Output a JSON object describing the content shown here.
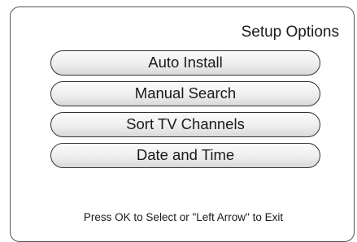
{
  "screen": {
    "title": "Setup Options",
    "menu": [
      {
        "label": "Auto Install"
      },
      {
        "label": "Manual Search"
      },
      {
        "label": "Sort TV Channels"
      },
      {
        "label": "Date and Time"
      }
    ],
    "hint": "Press OK to Select or \"Left Arrow\" to Exit"
  },
  "colors": {
    "background": "#ffffff",
    "border": "#333333",
    "button_top": "#fbfbfb",
    "button_bottom": "#d9d9d9",
    "text": "#1a1a1a"
  }
}
